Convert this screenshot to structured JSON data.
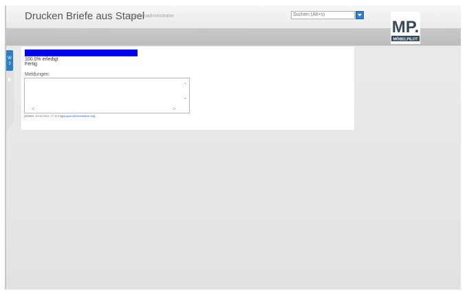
{
  "header": {
    "title": "Drucken Briefe aus Stapel",
    "user": "Systemadministrator",
    "search_placeholder": "Suchen (Alt+s)",
    "logo_text": "MP.",
    "logo_subtext": "MÖBELPILOT"
  },
  "sidebar": {
    "tab_label": "W 3"
  },
  "status": {
    "progress_percent": 100,
    "progress_text": "100.0% erledigt",
    "state_text": "Fertig",
    "messages_label": "Meldungen:"
  },
  "footer": {
    "info": "[ADMIN, 10.10.2014, 17:12:13]",
    "email": "[[support@moebelpilot.de]]"
  },
  "colors": {
    "progress": "#0000ee",
    "accent": "#2f7fd0",
    "sidebar_tab": "#2a7fc7"
  }
}
